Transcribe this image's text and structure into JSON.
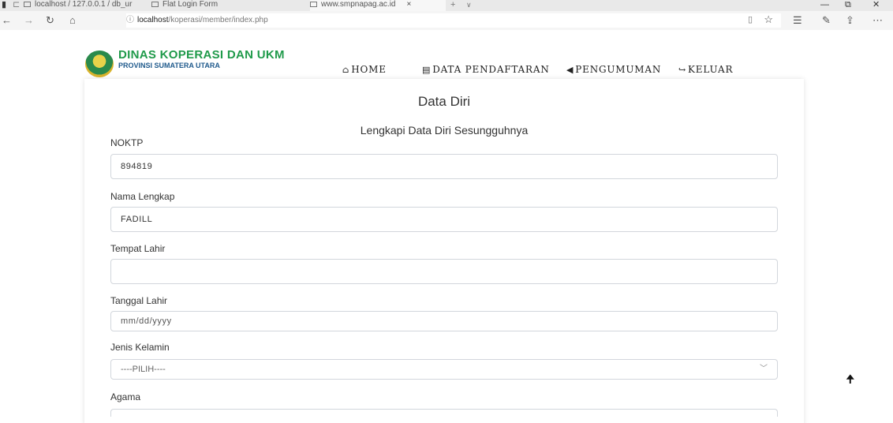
{
  "browser": {
    "tabs": [
      {
        "label": "localhost / 127.0.0.1 / db_ur"
      },
      {
        "label": "Flat Login Form"
      },
      {
        "label": "www.smpnapag.ac.id",
        "close": "×"
      }
    ],
    "new_tab": "+",
    "tab_list": "∨",
    "url_host": "localhost",
    "url_path": "/koperasi/member/index.php"
  },
  "site": {
    "title": "DINAS KOPERASI DAN UKM",
    "subtitle": "PROVINSI SUMATERA UTARA",
    "menu": [
      {
        "icon": "home-icon",
        "glyph": "⌂",
        "label": "HOME"
      },
      {
        "icon": "list-icon",
        "glyph": "▤",
        "label": "DATA PENDAFTARAN"
      },
      {
        "icon": "bullhorn-icon",
        "glyph": "◀",
        "label": "PENGUMUMAN"
      },
      {
        "icon": "sign-out-icon",
        "glyph": "↪",
        "label": "KELUAR"
      }
    ]
  },
  "form": {
    "title": "Data Diri",
    "subtitle": "Lengkapi Data Diri Sesungguhnya",
    "noktp_label": "NOKTP",
    "noktp_value": "894819",
    "nama_label": "Nama Lengkap",
    "nama_value": "FADILL",
    "tempat_label": "Tempat Lahir",
    "tempat_value": "",
    "tanggal_label": "Tanggal Lahir",
    "tanggal_placeholder": "mm/dd/yyyy",
    "jenis_label": "Jenis Kelamin",
    "jenis_selected": "----PILIH----",
    "agama_label": "Agama"
  },
  "scroll_top_icon": "arrow-up-icon"
}
